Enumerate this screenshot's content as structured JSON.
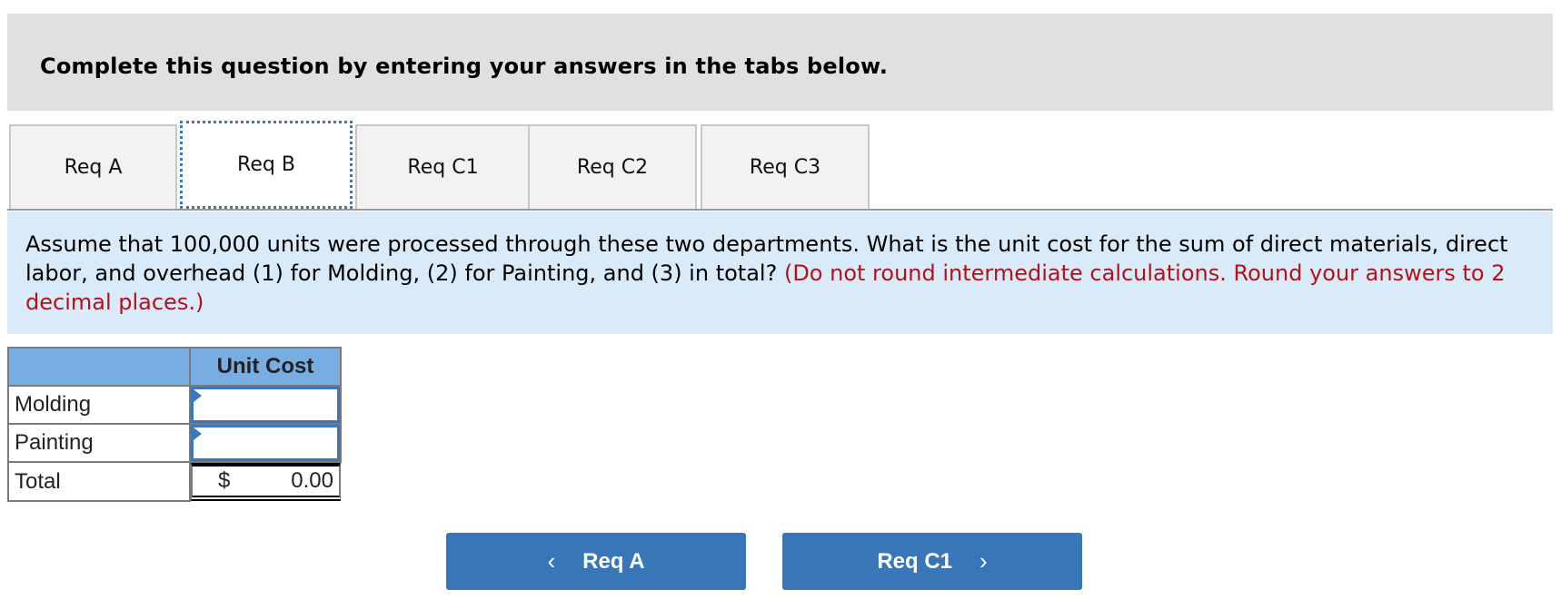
{
  "header": {
    "title": "Complete this question by entering your answers in the tabs below."
  },
  "tabs": [
    {
      "label": "Req A",
      "active": false
    },
    {
      "label": "Req B",
      "active": true
    },
    {
      "label": "Req C1",
      "active": false
    },
    {
      "label": "Req C2",
      "active": false
    },
    {
      "label": "Req C3",
      "active": false
    }
  ],
  "question": {
    "text": "Assume that 100,000 units were processed through these two departments. What is the unit cost for the sum of direct materials, direct labor, and overhead (1) for Molding, (2) for Painting, and (3) in total?",
    "instruction": "(Do not round intermediate calculations. Round your answers to 2 decimal places.)"
  },
  "table": {
    "column_header": "Unit Cost",
    "rows": [
      {
        "label": "Molding",
        "value": ""
      },
      {
        "label": "Painting",
        "value": ""
      }
    ],
    "total": {
      "label": "Total",
      "currency": "$",
      "value": "0.00"
    }
  },
  "nav": {
    "prev_label": "Req A",
    "next_label": "Req C1",
    "prev_icon": "chevron-left-icon",
    "next_icon": "chevron-right-icon"
  },
  "colors": {
    "header_bg": "#e0e0e0",
    "question_bg": "#d9eaf8",
    "instruction_red": "#b3121b",
    "table_header_bg": "#78ade2",
    "button_bg": "#3876b8",
    "focus_blue": "#3a78bb"
  }
}
